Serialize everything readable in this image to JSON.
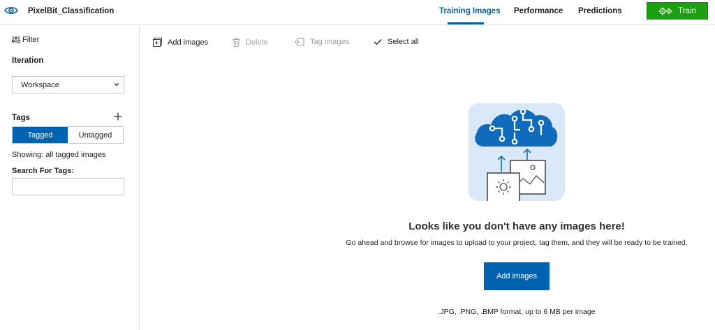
{
  "header": {
    "project_title": "PixelBit_Classification",
    "tabs": [
      {
        "label": "Training Images",
        "active": true
      },
      {
        "label": "Performance",
        "active": false
      },
      {
        "label": "Predictions",
        "active": false
      }
    ],
    "train_label": "Train",
    "accent_color": "#0063b1",
    "train_color": "#1ba10d"
  },
  "sidebar": {
    "filter_label": "Filter",
    "iteration_heading": "Iteration",
    "iteration_selected": "Workspace",
    "tags_heading": "Tags",
    "toggle": {
      "tagged": "Tagged",
      "untagged": "Untagged",
      "selected": "Tagged"
    },
    "showing_text": "Showing: all tagged images",
    "search_label": "Search For Tags:",
    "search_value": ""
  },
  "toolbar": {
    "add_images": "Add images",
    "delete": "Delete",
    "tag_images": "Tag images",
    "select_all": "Select all"
  },
  "empty_state": {
    "title": "Looks like you don't have any images here!",
    "description": "Go ahead and browse for images to upload to your project, tag them, and they will be ready to be trained.",
    "button_label": "Add images",
    "formats": ".JPG, .PNG, .BMP format, up to 6 MB per image"
  }
}
